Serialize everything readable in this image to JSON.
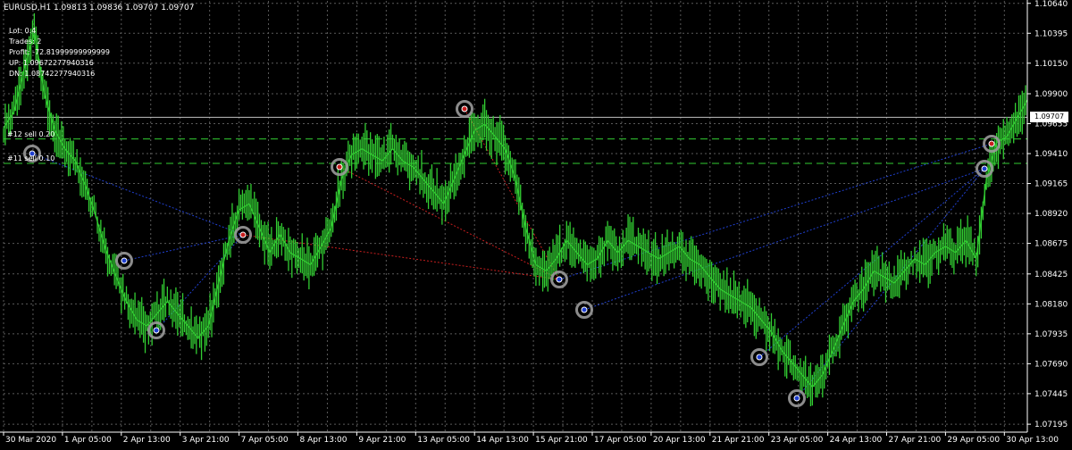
{
  "header": {
    "text": "EURUSD,H1  1.09813 1.09836 1.09707 1.09707"
  },
  "info": {
    "lines": [
      "Lot: 0.4",
      "Trades: 2",
      "Profit: -72.81999999999999",
      "UP: 1.096722779403​16",
      "DN: 1.087422779403​16"
    ]
  },
  "orders": [
    {
      "label": "#12 sell 0.20",
      "price": 1.0953
    },
    {
      "label": "#11 sell 0.10",
      "price": 1.0933
    }
  ],
  "current_price": {
    "label": "1.09707",
    "value": 1.09707
  },
  "colors": {
    "background": "#000000",
    "grid": "#5a5a5a",
    "candles": "#32cd32",
    "order_line": "#32cd32",
    "trade_buy_line": "#1f3fcf",
    "trade_sell_line": "#c81e1e",
    "marker_ring": "#9a9a9a",
    "axis_text": "#ffffff",
    "current_price_line": "#c0c0c0"
  },
  "chart_data": {
    "type": "line",
    "symbol": "EURUSD",
    "timeframe": "H1",
    "ylim": [
      1.0713,
      1.1066
    ],
    "y_ticks": [
      "1.10640",
      "1.10395",
      "1.10150",
      "1.09900",
      "1.09655",
      "1.09410",
      "1.09165",
      "1.08920",
      "1.08675",
      "1.08425",
      "1.08180",
      "1.07935",
      "1.07690",
      "1.07445",
      "1.07195"
    ],
    "x_ticks": [
      "30 Mar 2020",
      "1 Apr 05:00",
      "2 Apr 13:00",
      "3 Apr 21:00",
      "7 Apr 05:00",
      "8 Apr 13:00",
      "9 Apr 21:00",
      "13 Apr 05:00",
      "14 Apr 13:00",
      "15 Apr 21:00",
      "17 Apr 05:00",
      "20 Apr 13:00",
      "21 Apr 21:00",
      "23 Apr 05:00",
      "24 Apr 13:00",
      "27 Apr 21:00",
      "29 Apr 05:00",
      "30 Apr 13:00"
    ],
    "series": [
      {
        "x": [
          0,
          2,
          4,
          6,
          8,
          10,
          12,
          14,
          16,
          18,
          20,
          22,
          24,
          26,
          28,
          30,
          32,
          34,
          36,
          38,
          40,
          42,
          44,
          46,
          48,
          50,
          52,
          54,
          56,
          58,
          60,
          62,
          64,
          66,
          68,
          70,
          72,
          74,
          76,
          78,
          80,
          82,
          84,
          86,
          88,
          90,
          92,
          94,
          96,
          98,
          100,
          102,
          104,
          106,
          108,
          110,
          112,
          114,
          116,
          118,
          120,
          122,
          124,
          126,
          128,
          130,
          132,
          134,
          136,
          138,
          140,
          142,
          144,
          146,
          148,
          150,
          152,
          154,
          156,
          158,
          160,
          162,
          164,
          166,
          168,
          170,
          172,
          174,
          176,
          178,
          180,
          182,
          184,
          186,
          188,
          190,
          192,
          194,
          196,
          198,
          200
        ],
        "values": [
          1.0962,
          1.0975,
          1.101,
          1.104,
          1.099,
          1.096,
          1.0945,
          1.0935,
          1.0915,
          1.089,
          1.0862,
          1.084,
          1.082,
          1.0805,
          1.08,
          1.081,
          1.082,
          1.081,
          1.08,
          1.079,
          1.08,
          1.0835,
          1.087,
          1.0895,
          1.09,
          1.088,
          1.086,
          1.0875,
          1.086,
          1.0855,
          1.085,
          1.0865,
          1.088,
          1.092,
          1.094,
          1.0945,
          1.094,
          1.0935,
          1.0945,
          1.0935,
          1.093,
          1.092,
          1.091,
          1.09,
          1.092,
          1.094,
          1.096,
          1.0965,
          1.0955,
          1.0945,
          1.092,
          1.088,
          1.085,
          1.0845,
          1.0855,
          1.087,
          1.086,
          1.085,
          1.0855,
          1.087,
          1.086,
          1.087,
          1.0865,
          1.086,
          1.0855,
          1.086,
          1.0865,
          1.0855,
          1.085,
          1.084,
          1.083,
          1.0825,
          1.082,
          1.0815,
          1.0805,
          1.0795,
          1.078,
          1.077,
          1.076,
          1.075,
          1.076,
          1.078,
          1.08,
          1.082,
          1.083,
          1.0845,
          1.084,
          1.0835,
          1.0845,
          1.0855,
          1.085,
          1.086,
          1.0865,
          1.086,
          1.087,
          1.0855,
          1.092,
          1.095,
          1.0955,
          1.097,
          1.0985
        ]
      }
    ]
  }
}
